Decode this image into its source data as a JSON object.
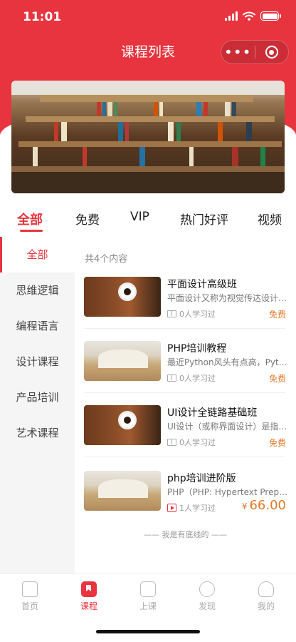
{
  "status_bar": {
    "time": "11:01"
  },
  "nav": {
    "title": "课程列表",
    "more_icon": "more-dots-icon",
    "close_icon": "target-circle-icon"
  },
  "colors": {
    "primary": "#e8343f",
    "price": "#e07a2a"
  },
  "top_tabs": [
    {
      "label": "全部",
      "active": true
    },
    {
      "label": "免费"
    },
    {
      "label": "VIP"
    },
    {
      "label": "热门好评"
    },
    {
      "label": "视频"
    }
  ],
  "sidebar": [
    {
      "label": "全部",
      "active": true
    },
    {
      "label": "思维逻辑"
    },
    {
      "label": "编程语言"
    },
    {
      "label": "设计课程"
    },
    {
      "label": "产品培训"
    },
    {
      "label": "艺术课程"
    }
  ],
  "list": {
    "count_label": "共4个内容",
    "courses": [
      {
        "title": "平面设计高级班",
        "desc": "平面设计又称为视觉传达设计，...",
        "learners": "0人学习过",
        "price": "免费",
        "thumb": "coffee-photo",
        "icon": "book-icon"
      },
      {
        "title": "PHP培训教程",
        "desc": "最近Python风头有点高，Pytho...",
        "learners": "0人学习过",
        "price": "免费",
        "thumb": "open-book-photo",
        "icon": "book-icon"
      },
      {
        "title": "UI设计全链路基础班",
        "desc": "UI设计（或称界面设计）是指对...",
        "learners": "0人学习过",
        "price": "免费",
        "thumb": "coffee-photo",
        "icon": "book-icon"
      },
      {
        "title": "php培训进阶版",
        "desc": "PHP（PHP: Hypertext Preproc...",
        "learners": "1人学习过",
        "price_symbol": "¥",
        "price": "66.00",
        "thumb": "open-book-photo",
        "icon": "play-icon"
      }
    ],
    "bottom_text": "—— 我是有底线的 ——"
  },
  "tabbar": [
    {
      "label": "首页",
      "icon": "home-icon"
    },
    {
      "label": "课程",
      "icon": "bookmark-icon",
      "active": true
    },
    {
      "label": "上课",
      "icon": "class-board-icon"
    },
    {
      "label": "发现",
      "icon": "discover-planet-icon"
    },
    {
      "label": "我的",
      "icon": "profile-icon"
    }
  ]
}
